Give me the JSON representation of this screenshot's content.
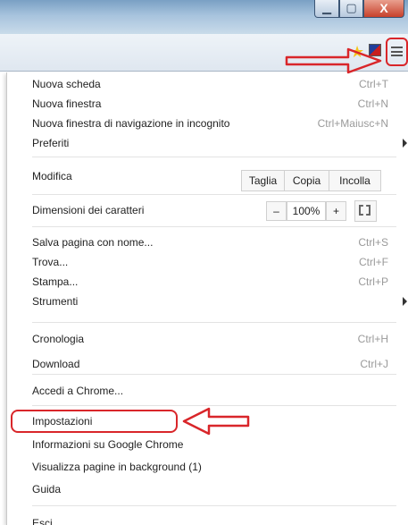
{
  "window": {
    "controls": [
      "minimize-icon",
      "maximize-icon",
      "close-icon"
    ],
    "close_glyph": "X"
  },
  "toolbar": {
    "icons": [
      "star-icon",
      "extension-icon",
      "menu-icon"
    ]
  },
  "menu": {
    "items": [
      {
        "label": "Nuova scheda",
        "shortcut": "Ctrl+T"
      },
      {
        "label": "Nuova finestra",
        "shortcut": "Ctrl+N"
      },
      {
        "label": "Nuova finestra di navigazione in incognito",
        "shortcut": "Ctrl+Maiusc+N"
      },
      {
        "label": "Preferiti",
        "shortcut": ""
      },
      {
        "label": "Modifica",
        "shortcut": ""
      },
      {
        "label": "Dimensioni dei caratteri",
        "shortcut": ""
      },
      {
        "label": "Salva pagina con nome...",
        "shortcut": "Ctrl+S"
      },
      {
        "label": "Trova...",
        "shortcut": "Ctrl+F"
      },
      {
        "label": "Stampa...",
        "shortcut": "Ctrl+P"
      },
      {
        "label": "Strumenti",
        "shortcut": ""
      },
      {
        "label": "Cronologia",
        "shortcut": "Ctrl+H"
      },
      {
        "label": "Download",
        "shortcut": "Ctrl+J"
      },
      {
        "label": "Accedi a Chrome...",
        "shortcut": ""
      },
      {
        "label": "Impostazioni",
        "shortcut": ""
      },
      {
        "label": "Informazioni su Google Chrome",
        "shortcut": ""
      },
      {
        "label": "Visualizza pagine in background (1)",
        "shortcut": ""
      },
      {
        "label": "Guida",
        "shortcut": ""
      },
      {
        "label": "Esci",
        "shortcut": ""
      }
    ],
    "edit": {
      "cut": "Taglia",
      "copy": "Copia",
      "paste": "Incolla"
    },
    "zoom": {
      "minus": "–",
      "value": "100%",
      "plus": "+"
    }
  },
  "colors": {
    "annotation": "#d9262a",
    "titlebar": "#7aa0c4"
  }
}
